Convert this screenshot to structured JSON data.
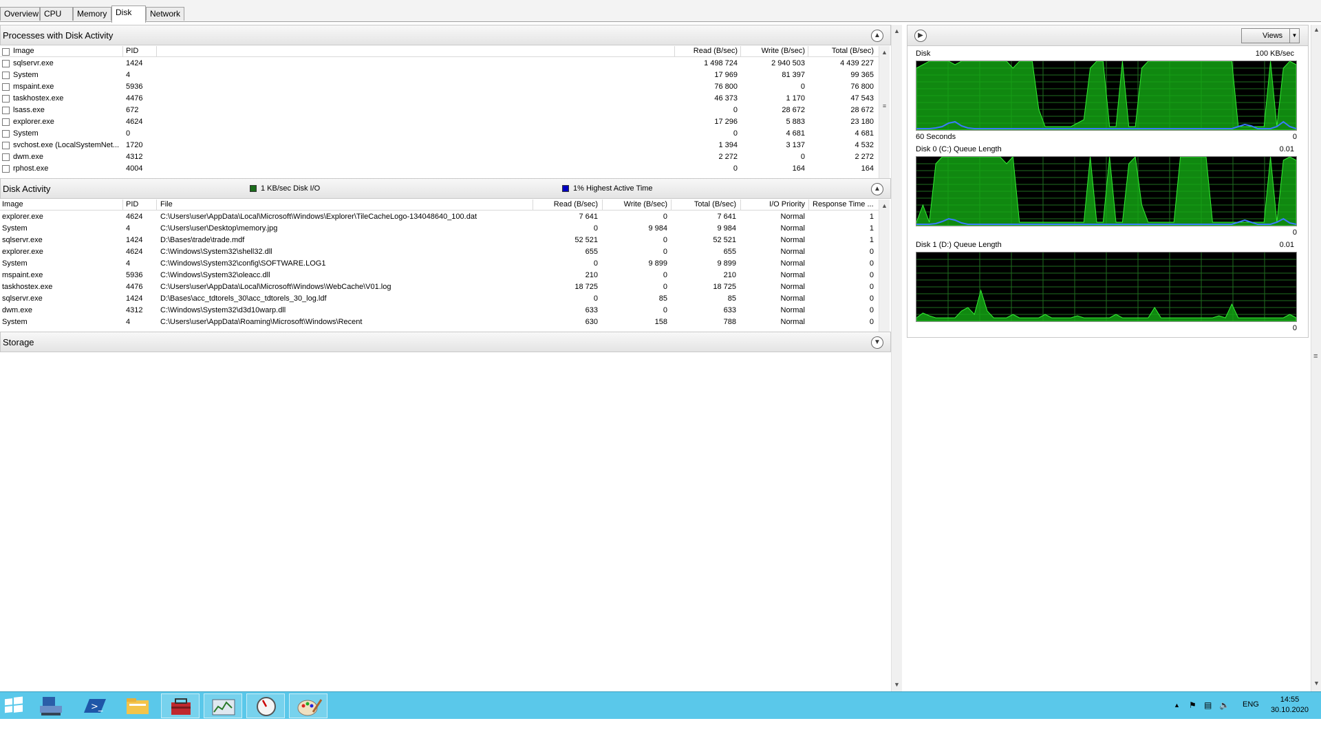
{
  "tabs": [
    {
      "label": "Overview"
    },
    {
      "label": "CPU"
    },
    {
      "label": "Memory"
    },
    {
      "label": "Disk",
      "active": true
    },
    {
      "label": "Network"
    }
  ],
  "processes": {
    "title": "Processes with Disk Activity",
    "columns": {
      "image": "Image",
      "pid": "PID",
      "read": "Read (B/sec)",
      "write": "Write (B/sec)",
      "total": "Total (B/sec)"
    },
    "rows": [
      {
        "image": "sqlservr.exe",
        "pid": "1424",
        "read": "1 498 724",
        "write": "2 940 503",
        "total": "4 439 227"
      },
      {
        "image": "System",
        "pid": "4",
        "read": "17 969",
        "write": "81 397",
        "total": "99 365"
      },
      {
        "image": "mspaint.exe",
        "pid": "5936",
        "read": "76 800",
        "write": "0",
        "total": "76 800"
      },
      {
        "image": "taskhostex.exe",
        "pid": "4476",
        "read": "46 373",
        "write": "1 170",
        "total": "47 543"
      },
      {
        "image": "lsass.exe",
        "pid": "672",
        "read": "0",
        "write": "28 672",
        "total": "28 672"
      },
      {
        "image": "explorer.exe",
        "pid": "4624",
        "read": "17 296",
        "write": "5 883",
        "total": "23 180"
      },
      {
        "image": "System",
        "pid": "0",
        "read": "0",
        "write": "4 681",
        "total": "4 681"
      },
      {
        "image": "svchost.exe (LocalSystemNet...",
        "pid": "1720",
        "read": "1 394",
        "write": "3 137",
        "total": "4 532"
      },
      {
        "image": "dwm.exe",
        "pid": "4312",
        "read": "2 272",
        "write": "0",
        "total": "2 272"
      },
      {
        "image": "rphost.exe",
        "pid": "4004",
        "read": "0",
        "write": "164",
        "total": "164"
      }
    ]
  },
  "disk_activity": {
    "title": "Disk Activity",
    "legend_io": "1 KB/sec Disk I/O",
    "legend_active": "1% Highest Active Time",
    "legend_io_color": "#1a6b1a",
    "legend_active_color": "#0000c0",
    "columns": {
      "image": "Image",
      "pid": "PID",
      "file": "File",
      "read": "Read (B/sec)",
      "write": "Write (B/sec)",
      "total": "Total (B/sec)",
      "priority": "I/O Priority",
      "response": "Response Time ..."
    },
    "rows": [
      {
        "image": "explorer.exe",
        "pid": "4624",
        "file": "C:\\Users\\user\\AppData\\Local\\Microsoft\\Windows\\Explorer\\TileCacheLogo-134048640_100.dat",
        "read": "7 641",
        "write": "0",
        "total": "7 641",
        "priority": "Normal",
        "response": "1"
      },
      {
        "image": "System",
        "pid": "4",
        "file": "C:\\Users\\user\\Desktop\\memory.jpg",
        "read": "0",
        "write": "9 984",
        "total": "9 984",
        "priority": "Normal",
        "response": "1"
      },
      {
        "image": "sqlservr.exe",
        "pid": "1424",
        "file": "D:\\Bases\\trade\\trade.mdf",
        "read": "52 521",
        "write": "0",
        "total": "52 521",
        "priority": "Normal",
        "response": "1"
      },
      {
        "image": "explorer.exe",
        "pid": "4624",
        "file": "C:\\Windows\\System32\\shell32.dll",
        "read": "655",
        "write": "0",
        "total": "655",
        "priority": "Normal",
        "response": "0"
      },
      {
        "image": "System",
        "pid": "4",
        "file": "C:\\Windows\\System32\\config\\SOFTWARE.LOG1",
        "read": "0",
        "write": "9 899",
        "total": "9 899",
        "priority": "Normal",
        "response": "0"
      },
      {
        "image": "mspaint.exe",
        "pid": "5936",
        "file": "C:\\Windows\\System32\\oleacc.dll",
        "read": "210",
        "write": "0",
        "total": "210",
        "priority": "Normal",
        "response": "0"
      },
      {
        "image": "taskhostex.exe",
        "pid": "4476",
        "file": "C:\\Users\\user\\AppData\\Local\\Microsoft\\Windows\\WebCache\\V01.log",
        "read": "18 725",
        "write": "0",
        "total": "18 725",
        "priority": "Normal",
        "response": "0"
      },
      {
        "image": "sqlservr.exe",
        "pid": "1424",
        "file": "D:\\Bases\\acc_tdtorels_30\\acc_tdtorels_30_log.ldf",
        "read": "0",
        "write": "85",
        "total": "85",
        "priority": "Normal",
        "response": "0"
      },
      {
        "image": "dwm.exe",
        "pid": "4312",
        "file": "C:\\Windows\\System32\\d3d10warp.dll",
        "read": "633",
        "write": "0",
        "total": "633",
        "priority": "Normal",
        "response": "0"
      },
      {
        "image": "System",
        "pid": "4",
        "file": "C:\\Users\\user\\AppData\\Roaming\\Microsoft\\Windows\\Recent",
        "read": "630",
        "write": "158",
        "total": "788",
        "priority": "Normal",
        "response": "0"
      }
    ]
  },
  "storage": {
    "title": "Storage"
  },
  "right_panel": {
    "views_label": "Views",
    "graphs": [
      {
        "name": "disk",
        "label": "Disk",
        "max_label": "100 KB/sec",
        "bottom_left": "60 Seconds",
        "bottom_right": "0"
      },
      {
        "name": "disk0",
        "label": "Disk 0 (C:) Queue Length",
        "max_label": "0.01",
        "bottom_left": "",
        "bottom_right": "0"
      },
      {
        "name": "disk1",
        "label": "Disk 1 (D:) Queue Length",
        "max_label": "0.01",
        "bottom_left": "",
        "bottom_right": "0"
      }
    ],
    "series": {
      "disk_green": [
        0.9,
        0.95,
        1,
        1,
        1,
        1,
        0.95,
        1,
        1,
        1,
        1,
        1,
        1,
        1,
        1,
        0.9,
        1,
        1,
        1,
        0.3,
        0.05,
        0.05,
        0.05,
        0.05,
        0.05,
        0.1,
        0.15,
        0.9,
        1,
        1,
        0.05,
        0.05,
        1,
        0.05,
        0.05,
        0.9,
        1,
        1,
        1,
        1,
        1,
        1,
        1,
        1,
        1,
        1,
        1,
        1,
        1,
        1,
        0.05,
        0.05,
        0.05,
        0.05,
        0.05,
        1,
        0.05,
        0.9,
        1,
        0.95
      ],
      "disk_blue": [
        0.02,
        0.02,
        0.02,
        0.03,
        0.05,
        0.1,
        0.12,
        0.06,
        0.03,
        0.02,
        0.02,
        0.02,
        0.02,
        0.02,
        0.02,
        0.02,
        0.02,
        0.02,
        0.02,
        0.02,
        0.02,
        0.02,
        0.02,
        0.02,
        0.02,
        0.02,
        0.02,
        0.02,
        0.02,
        0.02,
        0.02,
        0.02,
        0.02,
        0.02,
        0.02,
        0.02,
        0.02,
        0.02,
        0.02,
        0.02,
        0.02,
        0.02,
        0.02,
        0.02,
        0.02,
        0.02,
        0.02,
        0.02,
        0.02,
        0.02,
        0.05,
        0.08,
        0.06,
        0.02,
        0.02,
        0.02,
        0.05,
        0.12,
        0.05,
        0.02
      ],
      "disk0_green": [
        0.05,
        0.3,
        0.05,
        0.9,
        1,
        1,
        1,
        1,
        1,
        1,
        1,
        1,
        1,
        1,
        0.9,
        1,
        0.05,
        0.05,
        0.05,
        0.05,
        0.05,
        0.05,
        0.05,
        0.05,
        0.05,
        0.05,
        0.05,
        1,
        0.05,
        0.05,
        1,
        0.05,
        0.05,
        0.9,
        1,
        0.3,
        0.05,
        0.05,
        0.05,
        0.05,
        0.05,
        1,
        1,
        1,
        1,
        1,
        0.05,
        0.05,
        0.05,
        0.05,
        0.05,
        0.05,
        0.05,
        0.05,
        0.05,
        1,
        0.05,
        0.95,
        1,
        0.95
      ],
      "disk0_blue": [
        0.02,
        0.02,
        0.02,
        0.03,
        0.06,
        0.1,
        0.08,
        0.04,
        0.02,
        0.02,
        0.02,
        0.02,
        0.02,
        0.02,
        0.02,
        0.02,
        0.02,
        0.02,
        0.02,
        0.02,
        0.02,
        0.02,
        0.02,
        0.02,
        0.02,
        0.02,
        0.02,
        0.02,
        0.02,
        0.02,
        0.02,
        0.02,
        0.02,
        0.02,
        0.02,
        0.02,
        0.02,
        0.02,
        0.02,
        0.02,
        0.02,
        0.02,
        0.02,
        0.02,
        0.02,
        0.02,
        0.02,
        0.02,
        0.02,
        0.02,
        0.05,
        0.08,
        0.05,
        0.02,
        0.02,
        0.02,
        0.05,
        0.1,
        0.04,
        0.02
      ],
      "disk1_green": [
        0.05,
        0.12,
        0.08,
        0.05,
        0.05,
        0.05,
        0.05,
        0.15,
        0.2,
        0.1,
        0.45,
        0.15,
        0.05,
        0.05,
        0.05,
        0.1,
        0.05,
        0.05,
        0.05,
        0.05,
        0.1,
        0.05,
        0.05,
        0.05,
        0.05,
        0.08,
        0.05,
        0.05,
        0.05,
        0.05,
        0.05,
        0.1,
        0.05,
        0.05,
        0.05,
        0.05,
        0.05,
        0.2,
        0.05,
        0.05,
        0.05,
        0.05,
        0.05,
        0.05,
        0.05,
        0.05,
        0.05,
        0.08,
        0.05,
        0.25,
        0.05,
        0.05,
        0.05,
        0.05,
        0.05,
        0.05,
        0.05,
        0.05,
        0.1,
        0.05
      ]
    }
  },
  "taskbar": {
    "items": [
      {
        "name": "start-button-icon"
      },
      {
        "name": "server-manager-icon"
      },
      {
        "name": "powershell-icon"
      },
      {
        "name": "file-explorer-icon"
      },
      {
        "name": "toolbox-icon",
        "open": true
      },
      {
        "name": "resource-monitor-icon",
        "open": true
      },
      {
        "name": "performance-monitor-icon",
        "open": true
      },
      {
        "name": "paint-icon",
        "open": true
      }
    ],
    "lang": "ENG",
    "time": "14:55",
    "date": "30.10.2020"
  }
}
